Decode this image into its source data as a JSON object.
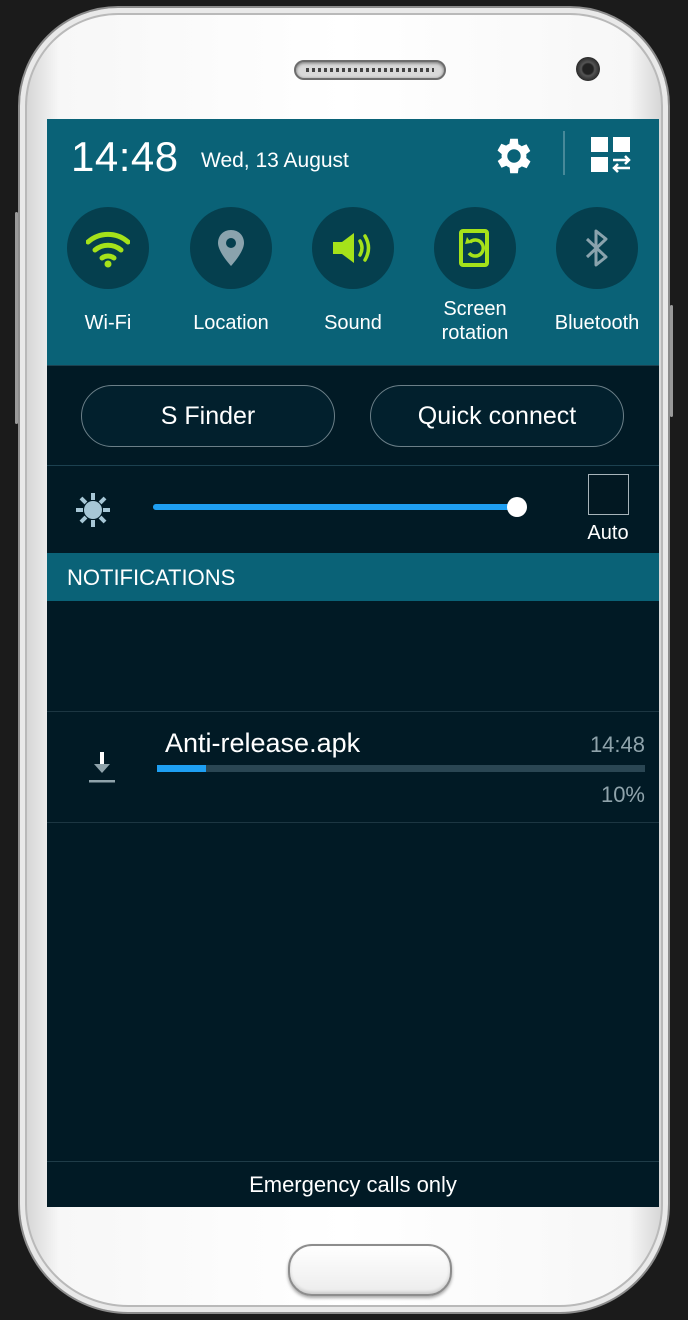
{
  "status": {
    "time": "14:48",
    "date": "Wed, 13 August"
  },
  "toggles": [
    {
      "label": "Wi-Fi",
      "icon": "wifi-icon",
      "active": true
    },
    {
      "label": "Location",
      "icon": "location-pin-icon",
      "active": false
    },
    {
      "label": "Sound",
      "icon": "sound-icon",
      "active": true
    },
    {
      "label": "Screen rotation",
      "label_line1": "Screen",
      "label_line2": "rotation",
      "icon": "screen-rotation-icon",
      "active": true
    },
    {
      "label": "Bluetooth",
      "icon": "bluetooth-icon",
      "active": false
    }
  ],
  "buttons": {
    "s_finder": "S Finder",
    "quick_connect": "Quick connect"
  },
  "brightness": {
    "level": 0.99,
    "auto_label": "Auto",
    "auto_checked": false
  },
  "notifications": {
    "header": "NOTIFICATIONS",
    "items": [
      {
        "title": "Anti-release.apk",
        "time": "14:48",
        "progress": 0.1,
        "percent_text": "10%",
        "icon": "download-icon"
      }
    ]
  },
  "footer": {
    "text": "Emergency calls only"
  },
  "colors": {
    "accent_green": "#a5e21a",
    "panel_teal": "#0a6277",
    "progress_blue": "#1e9ff2",
    "dark_bg": "#011a25"
  }
}
